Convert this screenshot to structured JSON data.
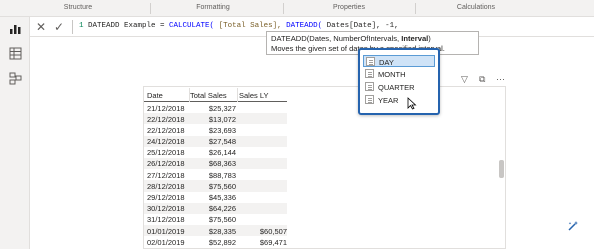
{
  "ribbon": {
    "groups": [
      "Structure",
      "Formatting",
      "Properties",
      "Calculations"
    ]
  },
  "formula_bar": {
    "cancel_icon": "close-icon",
    "commit_icon": "check-icon",
    "line_number": "1",
    "code_prefix": "DATEADD Example = ",
    "fn_calculate": "CALCULATE(",
    "measure": " [Total Sales],",
    "fn_dateadd": " DATEADD(",
    "column_arg": " Dates[Date],",
    "number_arg": " -1,"
  },
  "tooltip": {
    "signature_prefix": "DATEADD(Dates, NumberOfIntervals, ",
    "signature_bold": "Interval",
    "signature_suffix": ")",
    "description": "Moves the given set of dates by a specified interval."
  },
  "interval_dropdown": {
    "items": [
      "DAY",
      "MONTH",
      "QUARTER",
      "YEAR"
    ],
    "selected": "DAY",
    "border_color": "#2563ae",
    "selected_bg": "#cfe3f7"
  },
  "table": {
    "headers": [
      "Date",
      "Total Sales",
      "Sales LY"
    ],
    "rows": [
      [
        "21/12/2018",
        "$25,327",
        ""
      ],
      [
        "22/12/2018",
        "$13,072",
        ""
      ],
      [
        "22/12/2018",
        "$23,693",
        ""
      ],
      [
        "24/12/2018",
        "$27,548",
        ""
      ],
      [
        "25/12/2018",
        "$26,144",
        ""
      ],
      [
        "26/12/2018",
        "$68,363",
        ""
      ],
      [
        "27/12/2018",
        "$88,783",
        ""
      ],
      [
        "28/12/2018",
        "$75,560",
        ""
      ],
      [
        "29/12/2018",
        "$45,336",
        ""
      ],
      [
        "30/12/2018",
        "$64,226",
        ""
      ],
      [
        "31/12/2018",
        "$75,560",
        ""
      ],
      [
        "01/01/2019",
        "$28,335",
        "$60,507"
      ],
      [
        "02/01/2019",
        "$52,892",
        "$69,471"
      ]
    ]
  }
}
